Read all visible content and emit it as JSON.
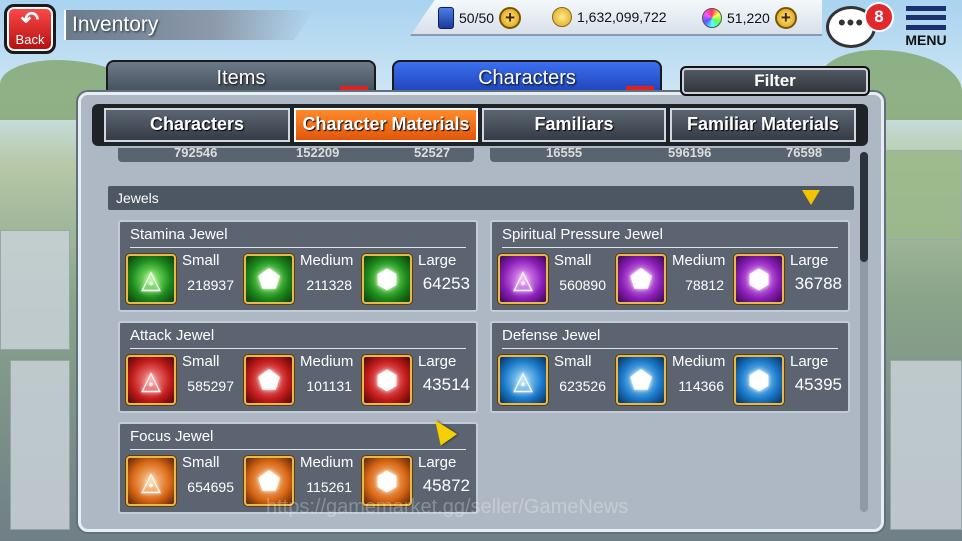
{
  "header": {
    "back_label": "Back",
    "title": "Inventory",
    "stamina": "50/50",
    "gold": "1,632,099,722",
    "orbs": "51,220",
    "chat_badge": "8",
    "menu_label": "MENU"
  },
  "tabs": {
    "items": "Items",
    "characters": "Characters",
    "filter": "Filter"
  },
  "subtabs": [
    "Characters",
    "Character Materials",
    "Familiars",
    "Familiar Materials"
  ],
  "partial_counts": [
    "792546",
    "152209",
    "52527",
    "16555",
    "596196",
    "76598"
  ],
  "section": {
    "title": "Jewels"
  },
  "jewels": [
    {
      "name": "Stamina Jewel",
      "color": "#1c8a1c",
      "items": [
        {
          "size": "Small",
          "count": "218937"
        },
        {
          "size": "Medium",
          "count": "211328"
        },
        {
          "size": "Large",
          "count": "64253"
        }
      ]
    },
    {
      "name": "Spiritual Pressure Jewel",
      "color": "#8b1fb8",
      "items": [
        {
          "size": "Small",
          "count": "560890"
        },
        {
          "size": "Medium",
          "count": "78812"
        },
        {
          "size": "Large",
          "count": "36788"
        }
      ]
    },
    {
      "name": "Attack Jewel",
      "color": "#c21b1b",
      "items": [
        {
          "size": "Small",
          "count": "585297"
        },
        {
          "size": "Medium",
          "count": "101131"
        },
        {
          "size": "Large",
          "count": "43514"
        }
      ]
    },
    {
      "name": "Defense Jewel",
      "color": "#1a78c9",
      "items": [
        {
          "size": "Small",
          "count": "623526"
        },
        {
          "size": "Medium",
          "count": "114366"
        },
        {
          "size": "Large",
          "count": "45395"
        }
      ]
    },
    {
      "name": "Focus Jewel",
      "color": "#d86615",
      "items": [
        {
          "size": "Small",
          "count": "654695"
        },
        {
          "size": "Medium",
          "count": "115261"
        },
        {
          "size": "Large",
          "count": "45872"
        }
      ]
    }
  ],
  "watermark": "https://gamemarket.gg/seller/GameNews"
}
